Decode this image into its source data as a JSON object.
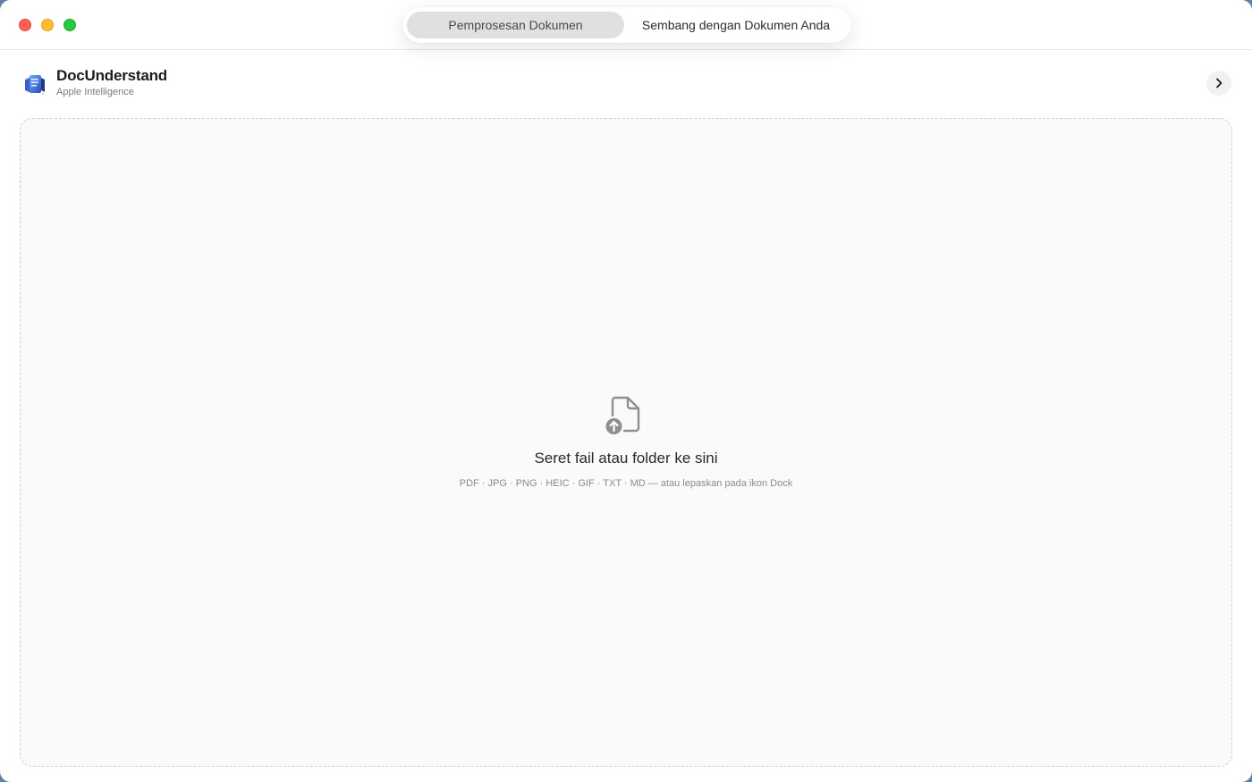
{
  "tabs": [
    {
      "label": "Pemprosesan Dokumen",
      "active": true
    },
    {
      "label": "Sembang dengan Dokumen Anda",
      "active": false
    }
  ],
  "app": {
    "name": "DocUnderstand",
    "subtitle": "Apple Intelligence",
    "icon": "document-app-icon"
  },
  "dropzone": {
    "title": "Seret fail atau folder ke sini",
    "formats": "PDF · JPG · PNG · HEIC · GIF · TXT · MD — atau lepaskan pada ikon Dock",
    "icon": "document-upload-icon"
  },
  "colors": {
    "close": "#ff5f57",
    "minimize": "#febc2e",
    "maximize": "#28c840",
    "active_tab": "#e0e0e0"
  }
}
